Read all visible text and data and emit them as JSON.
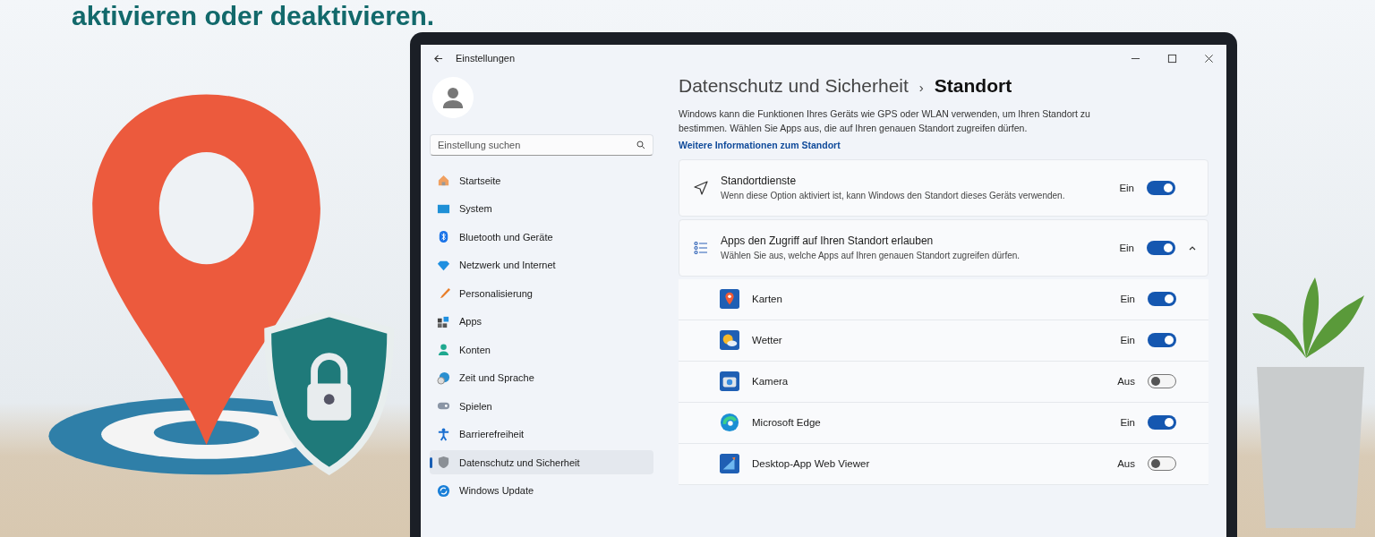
{
  "headline": "aktivieren oder deaktivieren.",
  "window": {
    "title": "Einstellungen"
  },
  "sidebar": {
    "search": {
      "placeholder": "Einstellung suchen"
    },
    "items": [
      {
        "label": "Startseite",
        "selected": false
      },
      {
        "label": "System",
        "selected": false
      },
      {
        "label": "Bluetooth und Geräte",
        "selected": false
      },
      {
        "label": "Netzwerk und Internet",
        "selected": false
      },
      {
        "label": "Personalisierung",
        "selected": false
      },
      {
        "label": "Apps",
        "selected": false
      },
      {
        "label": "Konten",
        "selected": false
      },
      {
        "label": "Zeit und Sprache",
        "selected": false
      },
      {
        "label": "Spielen",
        "selected": false
      },
      {
        "label": "Barrierefreiheit",
        "selected": false
      },
      {
        "label": "Datenschutz und Sicherheit",
        "selected": true
      },
      {
        "label": "Windows Update",
        "selected": false
      }
    ]
  },
  "breadcrumb": {
    "parent": "Datenschutz und Sicherheit",
    "separator": "›",
    "current": "Standort"
  },
  "description": "Windows kann die Funktionen Ihres Geräts wie GPS oder WLAN verwenden, um Ihren Standort zu bestimmen. Wählen Sie Apps aus, die auf Ihren genauen Standort zugreifen dürfen.",
  "link": "Weitere Informationen zum Standort",
  "settings": [
    {
      "title": "Standortdienste",
      "subtitle": "Wenn diese Option aktiviert ist, kann Windows den Standort dieses Geräts verwenden.",
      "state": "Ein",
      "on": true
    },
    {
      "title": "Apps den Zugriff auf Ihren Standort erlauben",
      "subtitle": "Wählen Sie aus, welche Apps auf Ihren genauen Standort zugreifen dürfen.",
      "state": "Ein",
      "on": true,
      "expanded": true
    }
  ],
  "apps": [
    {
      "name": "Karten",
      "state": "Ein",
      "on": true
    },
    {
      "name": "Wetter",
      "state": "Ein",
      "on": true
    },
    {
      "name": "Kamera",
      "state": "Aus",
      "on": false
    },
    {
      "name": "Microsoft Edge",
      "state": "Ein",
      "on": true
    },
    {
      "name": "Desktop-App Web Viewer",
      "state": "Aus",
      "on": false
    }
  ]
}
